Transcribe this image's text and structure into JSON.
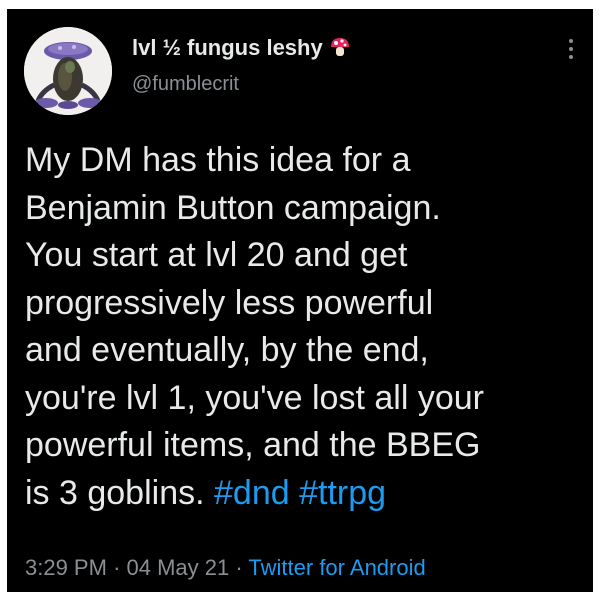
{
  "author": {
    "display_name": "lvl ½ fungus leshy",
    "name_emoji": "mushroom-icon",
    "handle": "@fumblecrit",
    "avatar": "fungus-leshy-figure-icon"
  },
  "menu_icon": "more-vertical-icon",
  "tweet": {
    "lines": [
      "My DM has this idea for a",
      "Benjamin Button campaign.",
      "You start at lvl 20 and get",
      "progressively less powerful",
      "and eventually, by the end,",
      "you're lvl 1, you've lost all your",
      "powerful items, and the BBEG"
    ],
    "last_line_text": "is 3 goblins.",
    "hashtags": [
      "#dnd",
      "#ttrpg"
    ]
  },
  "meta": {
    "time": "3:29 PM",
    "separator": "·",
    "date": "04 May 21",
    "source": "Twitter for Android"
  },
  "colors": {
    "background": "#000000",
    "text": "#e7e9ea",
    "secondary": "#8b8f94",
    "link": "#1d9bf0"
  }
}
